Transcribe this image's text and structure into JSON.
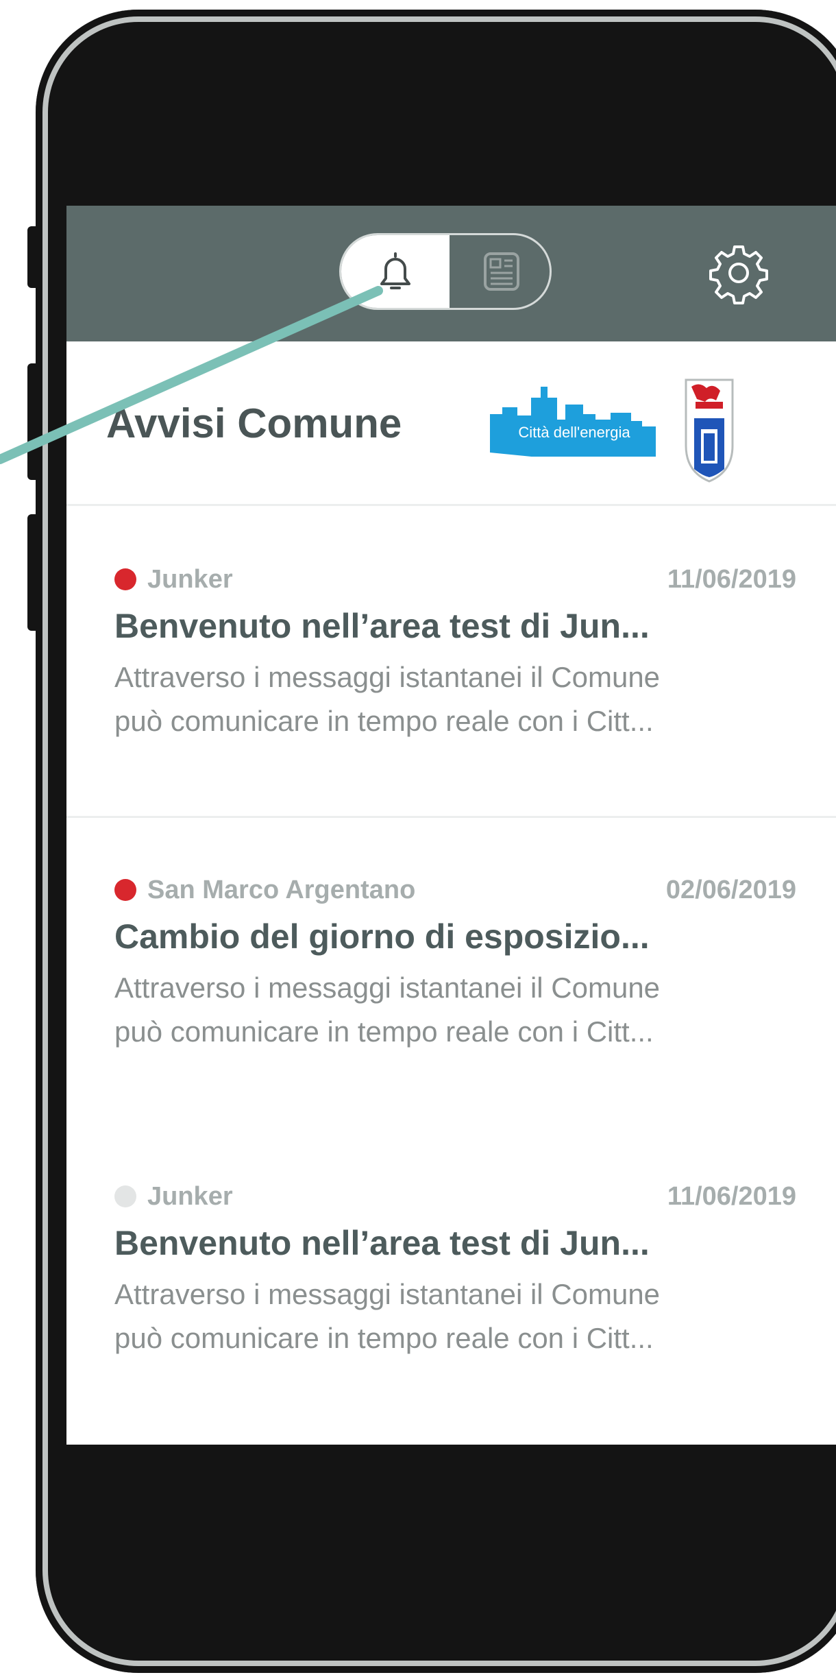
{
  "colors": {
    "header_bg": "#5c6b6a",
    "phone_frame": "#141414",
    "accent_line": "#7bc0b6",
    "unread_dot": "#d8272d",
    "read_dot": "#e3e5e5",
    "title_text": "#4d5b5c",
    "logo_blue": "#1e9fdc"
  },
  "header": {
    "toggle": [
      {
        "icon": "bell-icon",
        "selected": true
      },
      {
        "icon": "newspaper-icon",
        "selected": false
      }
    ],
    "settings_icon": "gear-icon"
  },
  "page": {
    "title": "Avvisi Comune",
    "logo_text": "Città dell'energia"
  },
  "notices": [
    {
      "source": "Junker",
      "date": "11/06/2019",
      "title": "Benvenuto nell’area test di Jun...",
      "body_line1": "Attraverso i messaggi istantanei il Comune",
      "body_line2": "può comunicare in tempo reale con i Citt...",
      "unread": true
    },
    {
      "source": "San Marco Argentano",
      "date": "02/06/2019",
      "title": "Cambio del giorno di esposizio...",
      "body_line1": "Attraverso i messaggi istantanei il Comune",
      "body_line2": "può comunicare in tempo reale con i Citt...",
      "unread": true
    },
    {
      "source": "Junker",
      "date": "11/06/2019",
      "title": "Benvenuto nell’area test di Jun...",
      "body_line1": "Attraverso i messaggi istantanei il Comune",
      "body_line2": "può comunicare in tempo reale con i Citt...",
      "unread": false
    }
  ]
}
